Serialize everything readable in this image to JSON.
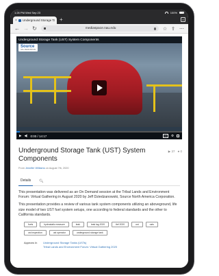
{
  "status_bar": {
    "time": "1:26 PM",
    "date": "Wed Sep 23",
    "battery": "100%"
  },
  "browser": {
    "tab_title": "Underground Storage Tank (UST)",
    "tab_count": "8",
    "url": "mediaspace.nau.edu",
    "back_icon": "back-arrow-icon",
    "forward_icon": "forward-arrow-icon",
    "lock_icon": "lock-icon",
    "mic_icon": "mic-icon",
    "bookmark_icon": "star-icon",
    "share_icon": "share-icon",
    "menu_icon": "more-icon"
  },
  "player": {
    "video_title": "Underground Storage Tank (UST) System Components",
    "logo_text": "Source",
    "logo_sub": "NAU MEDIASPACE",
    "time_current": "0:00",
    "time_total": "14:17",
    "progress": 0.02,
    "captions_label": "CC"
  },
  "page": {
    "title": "Underground Storage Tank (UST) System Components",
    "views": "37",
    "comments": "0",
    "byline_prefix": "From ",
    "author": "Jennifer Williams",
    "byline_suffix": " on August 7th, 2020"
  },
  "tabs": {
    "details": "Details"
  },
  "description": {
    "p1": "This presentation was delivered as an On Demand session at the Tribal Lands and Environment Forum: Virtual Gathering in August 2020 by Jeff Dziedzanowski, Source North America Corporation.",
    "p2": "This presentation provides a review of various tank system components utilizing an aboveground, life size model of two UST fuel system setups, one according to federal standards and the other to California standards."
  },
  "tags": [
    "fuels",
    "hydrostatic measure",
    "leak",
    "leak lag 2020",
    "tlef 2020",
    "ust",
    "usts",
    "ust inspection",
    "ust operator",
    "underground storage tank"
  ],
  "appears_in": {
    "label": "Appears In",
    "links": [
      "Underground Storage Tanks (USTs)",
      "Tribal Lands and Environment Forum: Virtual Gathering 2020"
    ]
  },
  "colors": {
    "accent": "#1f5fa8",
    "link": "#2a6fb5",
    "tank_red": "#c8262f",
    "rail_yellow": "#e5c21a"
  }
}
